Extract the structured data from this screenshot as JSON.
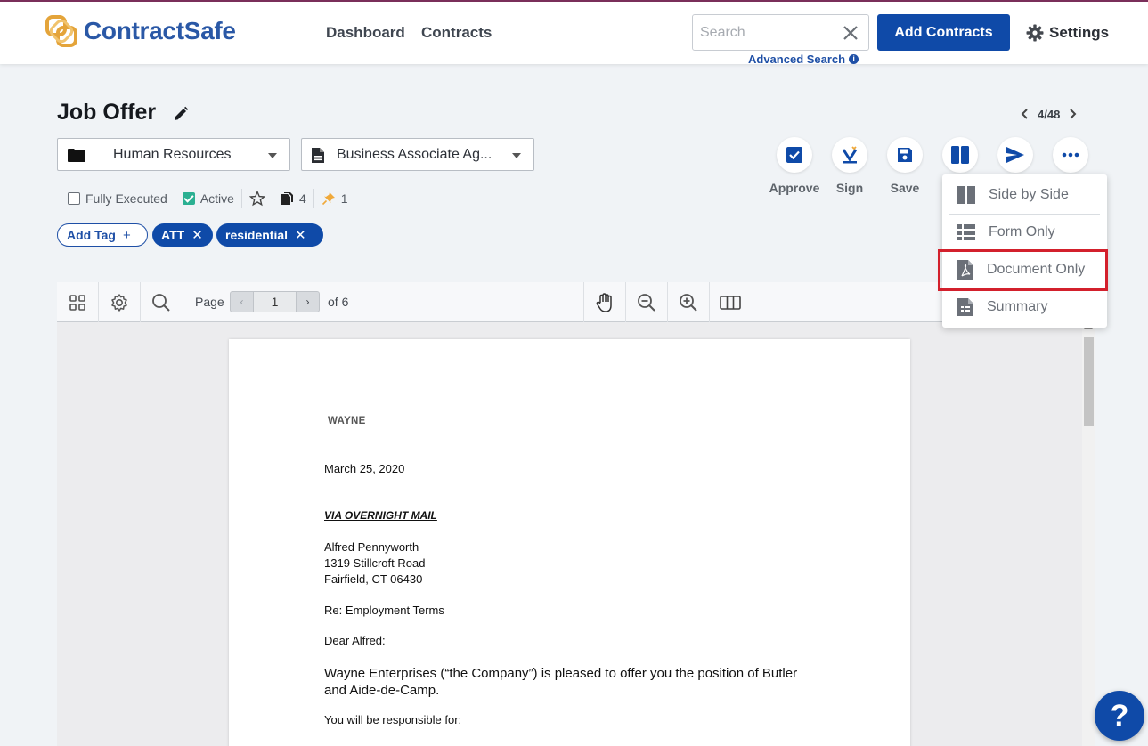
{
  "app": {
    "name": "ContractSafe",
    "brand_color": "#2a58a6",
    "accent_color": "#0f4aa8",
    "logo_color": "#e4a43a"
  },
  "nav": {
    "dashboard": "Dashboard",
    "contracts": "Contracts"
  },
  "search": {
    "placeholder": "Search",
    "value": "",
    "advanced_label": "Advanced Search",
    "clear_icon": "close-icon"
  },
  "header": {
    "add_button": "Add Contracts",
    "settings_label": "Settings"
  },
  "contract": {
    "title": "Job Offer",
    "pager": {
      "current": "4/48"
    },
    "folder": "Human Resources",
    "type": "Business Associate Ag...",
    "status": {
      "fully_executed": "Fully Executed",
      "fully_executed_checked": false,
      "active": "Active",
      "active_checked": true
    },
    "file_count": "4",
    "pin_count": "1",
    "tags": {
      "add_label": "Add Tag",
      "items": [
        "ATT",
        "residential"
      ]
    }
  },
  "actions": {
    "approve": "Approve",
    "sign": "Sign",
    "save": "Save"
  },
  "view_menu": {
    "items": [
      "Side by Side",
      "Form Only",
      "Document Only",
      "Summary"
    ],
    "highlighted": "Document Only"
  },
  "viewer": {
    "page_label": "Page",
    "page_value": "1",
    "page_total": "of 6"
  },
  "document": {
    "letterhead": "WAYNE",
    "date": "March 25, 2020",
    "delivery": "VIA OVERNIGHT MAIL",
    "address": [
      "Alfred Pennyworth",
      "1319 Stillcroft Road",
      "Fairfield, CT 06430"
    ],
    "re": "Re: Employment Terms",
    "salutation": "Dear Alfred:",
    "body": [
      "Wayne Enterprises (“the Company”) is pleased to offer you the position of Butler",
      "and Aide-de-Camp."
    ],
    "responsibilities": "You will be responsible for:"
  },
  "help": {
    "label": "?"
  }
}
